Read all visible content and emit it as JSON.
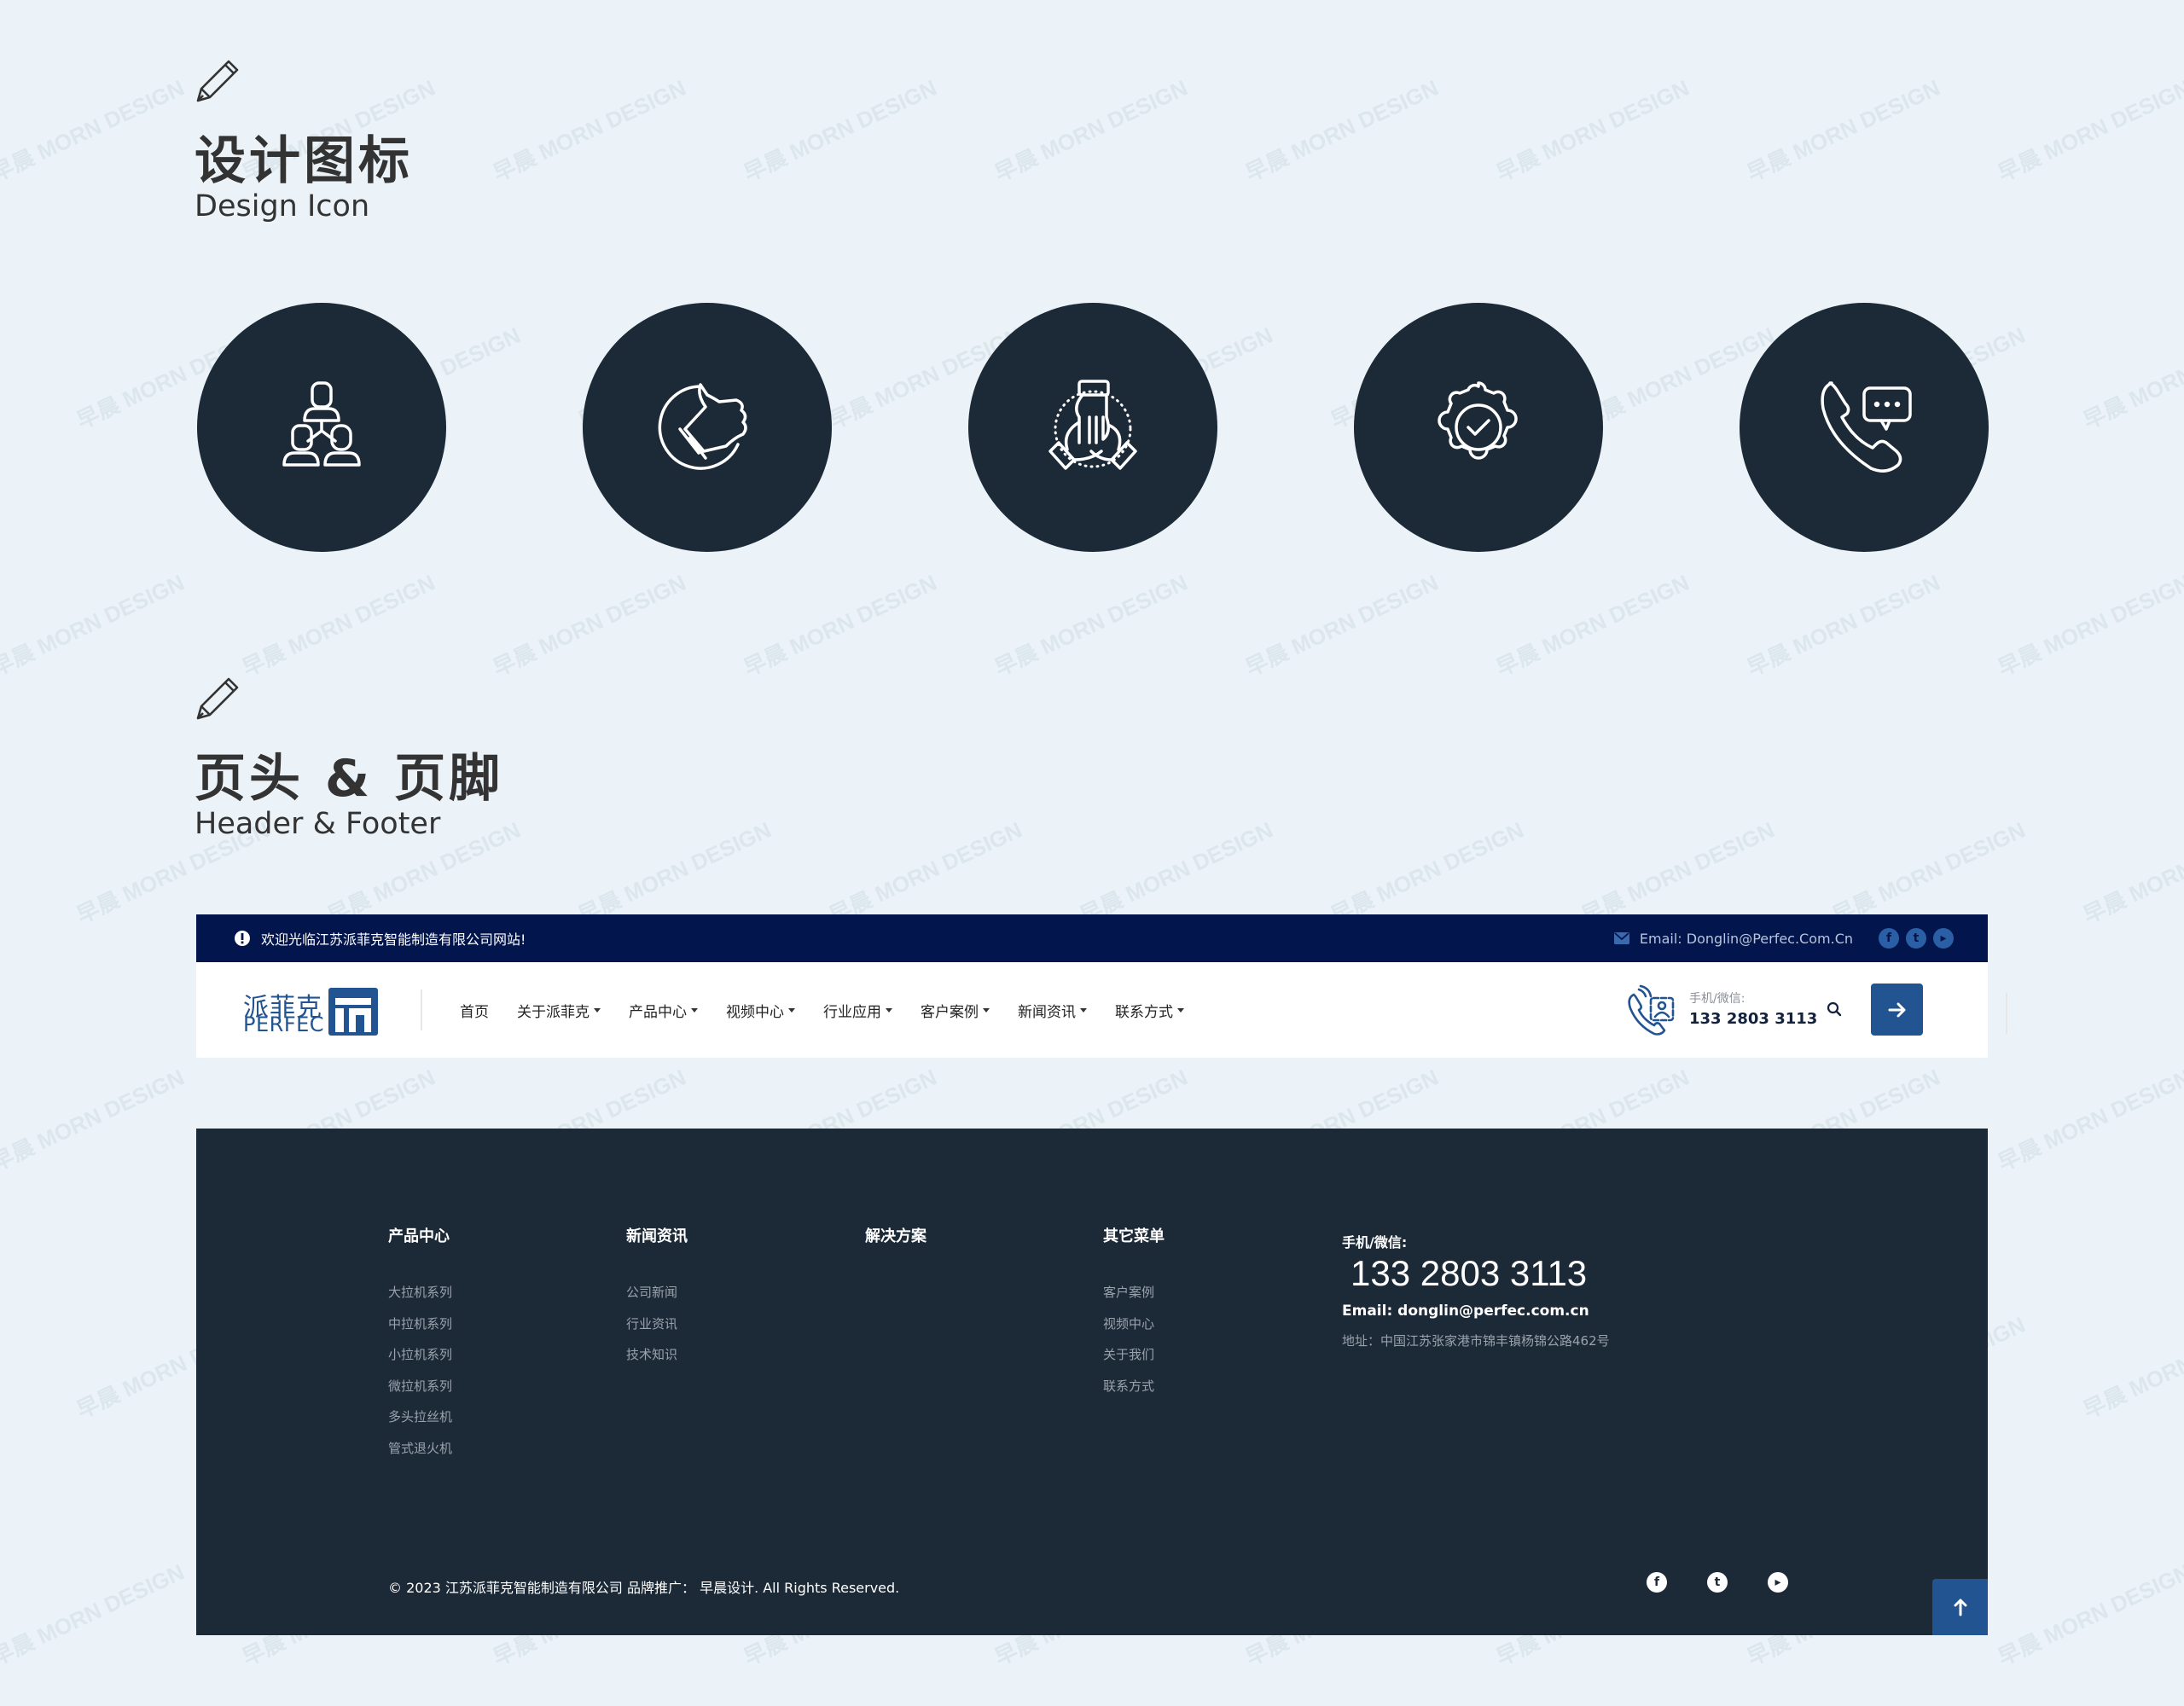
{
  "sections": [
    {
      "title": "设计图标",
      "subtitle": "Design Icon"
    },
    {
      "title": "页头 & 页脚",
      "subtitle": "Header & Footer"
    }
  ],
  "icons": [
    {
      "name": "team-hierarchy-icon"
    },
    {
      "name": "thumbs-up-icon"
    },
    {
      "name": "teamwork-hands-icon"
    },
    {
      "name": "gear-check-icon"
    },
    {
      "name": "phone-chat-icon"
    }
  ],
  "topbar": {
    "welcome": "欢迎光临江苏派菲克智能制造有限公司网站!",
    "email": "Email: Donglin@Perfec.Com.Cn",
    "social": [
      "facebook",
      "twitter",
      "youtube"
    ]
  },
  "header": {
    "logo_cn": "派菲克",
    "logo_en": "PERFEC",
    "nav": [
      {
        "label": "首页",
        "dropdown": false
      },
      {
        "label": "关于派菲克",
        "dropdown": true
      },
      {
        "label": "产品中心",
        "dropdown": true
      },
      {
        "label": "视频中心",
        "dropdown": true
      },
      {
        "label": "行业应用",
        "dropdown": true
      },
      {
        "label": "客户案例",
        "dropdown": true
      },
      {
        "label": "新闻资讯",
        "dropdown": true
      },
      {
        "label": "联系方式",
        "dropdown": true
      }
    ],
    "phone_label": "手机/微信:",
    "phone": "133 2803 3113"
  },
  "footer": {
    "columns": [
      {
        "title": "产品中心",
        "links": [
          "大拉机系列",
          "中拉机系列",
          "小拉机系列",
          "微拉机系列",
          "多头拉丝机",
          "管式退火机"
        ]
      },
      {
        "title": "新闻资讯",
        "links": [
          "公司新闻",
          "行业资讯",
          "技术知识"
        ]
      },
      {
        "title": "解决方案",
        "links": []
      },
      {
        "title": "其它菜单",
        "links": [
          "客户案例",
          "视频中心",
          "关于我们",
          "联系方式"
        ]
      }
    ],
    "contact": {
      "label": "手机/微信:",
      "phone": "133 2803 3113",
      "email": "Email: donglin@perfec.com.cn",
      "address": "地址：中国江苏张家港市锦丰镇杨锦公路462号"
    },
    "copyright": "© 2023 江苏派菲克智能制造有限公司 品牌推广： 早晨设计. All Rights Reserved.",
    "social": [
      "facebook",
      "twitter",
      "youtube"
    ]
  },
  "colors": {
    "page_bg": "#ebf3f8",
    "icon_circle": "#1c2937",
    "topbar": "#02154d",
    "brand_blue": "#235492",
    "footer": "#1c2937"
  },
  "watermark": "早晨 MORN DESIGN"
}
